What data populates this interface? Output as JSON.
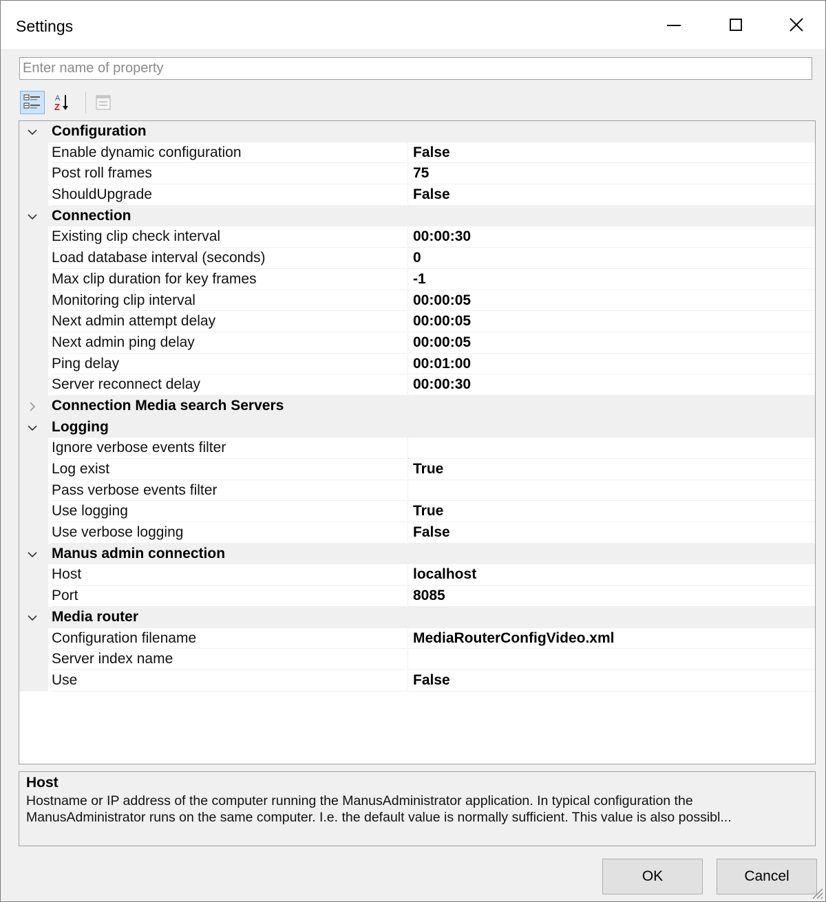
{
  "window": {
    "title": "Settings"
  },
  "search": {
    "placeholder": "Enter name of property",
    "value": ""
  },
  "toolbar": {
    "icons": [
      "categorized-icon",
      "alphabetical-sort-icon",
      "property-pages-icon"
    ],
    "active": "categorized"
  },
  "grid": {
    "categories": [
      {
        "label": "Configuration",
        "expanded": true,
        "properties": [
          {
            "name": "Enable dynamic configuration",
            "value": "False"
          },
          {
            "name": "Post roll frames",
            "value": "75"
          },
          {
            "name": "ShouldUpgrade",
            "value": "False"
          }
        ]
      },
      {
        "label": "Connection",
        "expanded": true,
        "properties": [
          {
            "name": "Existing clip check interval",
            "value": "00:00:30"
          },
          {
            "name": "Load database interval (seconds)",
            "value": "0"
          },
          {
            "name": "Max clip duration for key frames",
            "value": "-1"
          },
          {
            "name": "Monitoring clip interval",
            "value": "00:00:05"
          },
          {
            "name": "Next admin attempt delay",
            "value": "00:00:05"
          },
          {
            "name": "Next admin ping delay",
            "value": "00:00:05"
          },
          {
            "name": "Ping delay",
            "value": "00:01:00"
          },
          {
            "name": "Server reconnect delay",
            "value": "00:00:30"
          }
        ]
      },
      {
        "label": "Connection Media search Servers",
        "expanded": false,
        "properties": []
      },
      {
        "label": "Logging",
        "expanded": true,
        "properties": [
          {
            "name": "Ignore verbose events filter",
            "value": ""
          },
          {
            "name": "Log exist",
            "value": "True"
          },
          {
            "name": "Pass verbose events filter",
            "value": ""
          },
          {
            "name": "Use logging",
            "value": "True"
          },
          {
            "name": "Use verbose logging",
            "value": "False"
          }
        ]
      },
      {
        "label": "Manus admin connection",
        "expanded": true,
        "properties": [
          {
            "name": "Host",
            "value": "localhost"
          },
          {
            "name": "Port",
            "value": "8085"
          }
        ]
      },
      {
        "label": "Media router",
        "expanded": true,
        "properties": [
          {
            "name": "Configuration filename",
            "value": "MediaRouterConfigVideo.xml"
          },
          {
            "name": "Server index name",
            "value": ""
          },
          {
            "name": "Use",
            "value": "False"
          }
        ]
      }
    ]
  },
  "help": {
    "title": "Host",
    "text": "Hostname or IP address of the computer running the ManusAdministrator application. In typical configuration the ManusAdministrator runs on the same computer. I.e. the default value is normally sufficient. This value is also possibl..."
  },
  "buttons": {
    "ok": "OK",
    "cancel": "Cancel"
  },
  "colors": {
    "gutter": "#f0f0f0",
    "active_tool": "#cce4f7"
  }
}
